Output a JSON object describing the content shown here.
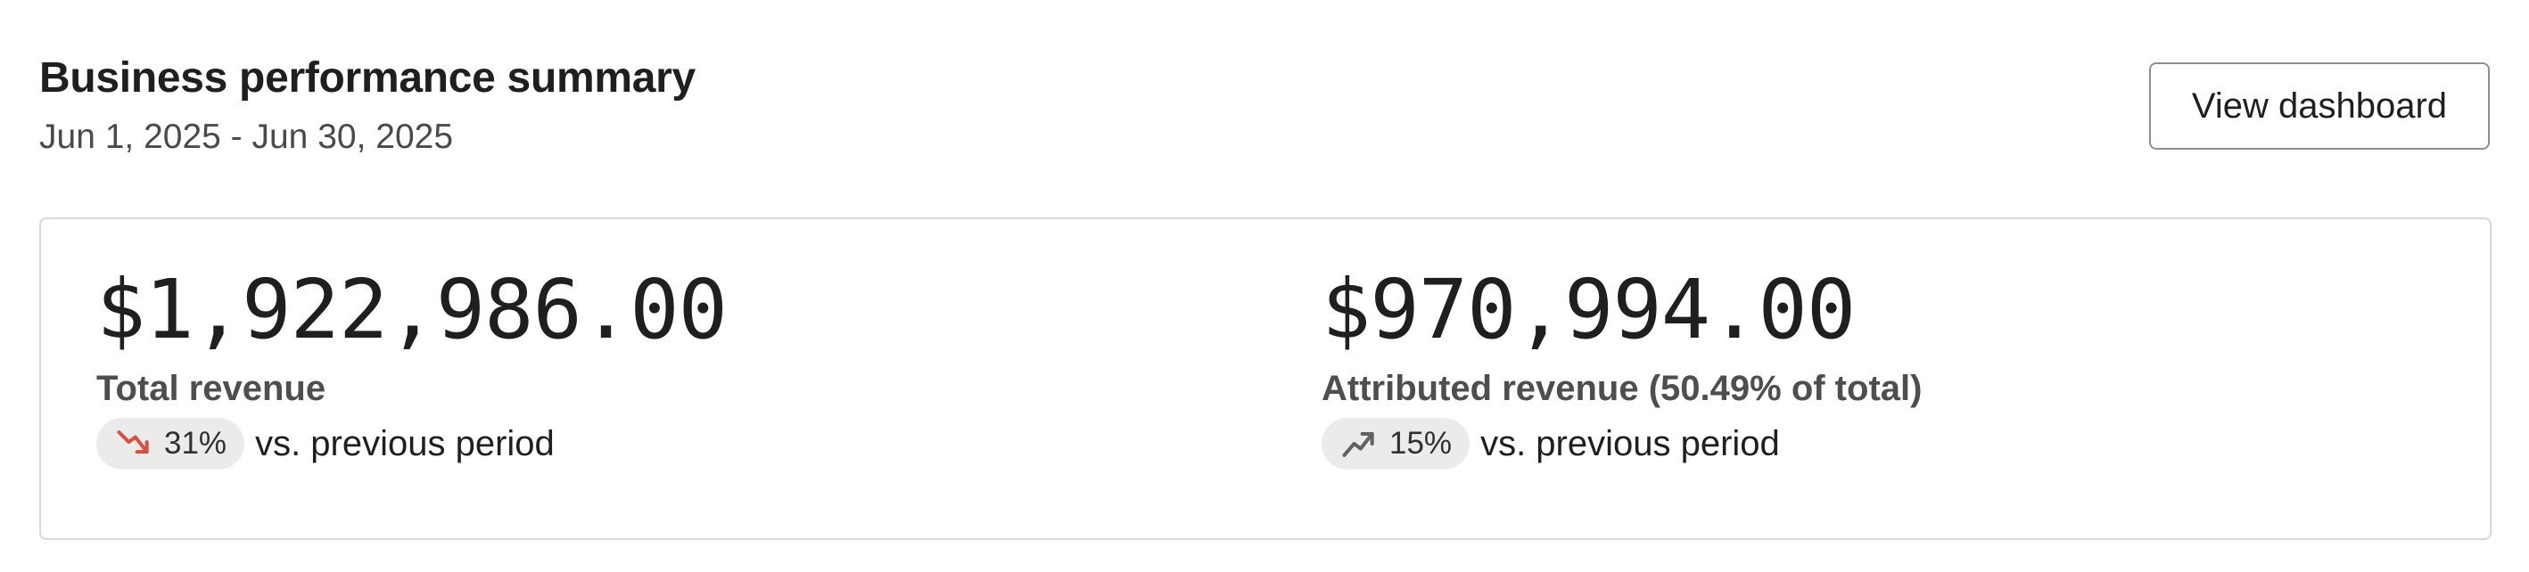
{
  "header": {
    "title": "Business performance summary",
    "date_range": "Jun 1, 2025 - Jun 30, 2025",
    "view_dashboard_label": "View dashboard"
  },
  "metrics": [
    {
      "amount": "$1,922,986.00",
      "label": "Total revenue",
      "change": "31%",
      "trend": "down",
      "trend_icon": "trend-down-icon",
      "trend_color": "#d5533d",
      "comparison": "vs. previous period"
    },
    {
      "amount": "$970,994.00",
      "label": "Attributed revenue (50.49% of total)",
      "change": "15%",
      "trend": "up",
      "trend_icon": "trend-up-icon",
      "trend_color": "#616161",
      "comparison": "vs. previous period"
    }
  ]
}
